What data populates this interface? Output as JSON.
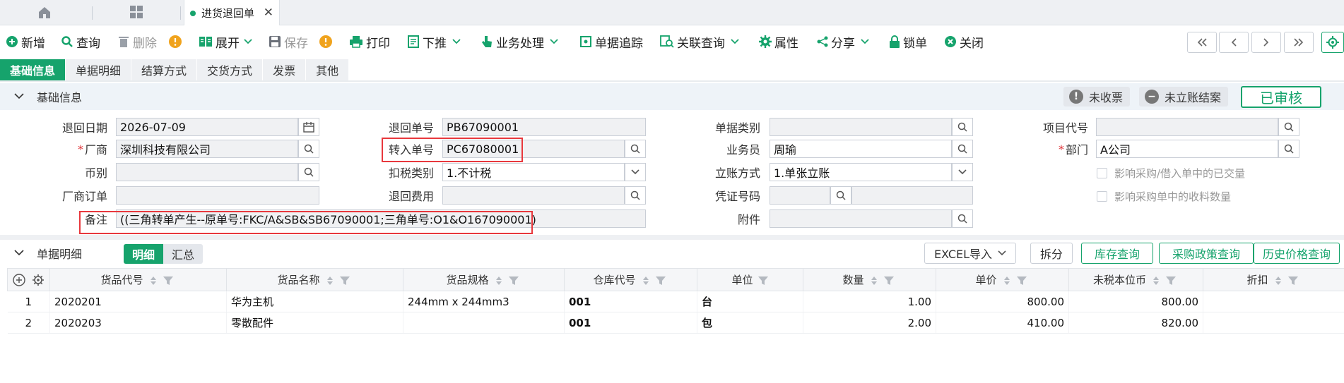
{
  "tabbar": {
    "active_tab": "进货退回单"
  },
  "toolbar": {
    "new": "新增",
    "query": "查询",
    "delete": "删除",
    "expand": "展开",
    "save": "保存",
    "print": "打印",
    "push_down": "下推",
    "business": "业务处理",
    "trace": "单据追踪",
    "related": "关联查询",
    "properties": "属性",
    "share": "分享",
    "lock": "锁单",
    "close": "关闭"
  },
  "subtabs": [
    "基础信息",
    "单据明细",
    "结算方式",
    "交货方式",
    "发票",
    "其他"
  ],
  "basic": {
    "title": "基础信息",
    "badge_unreceived": "未收票",
    "badge_unsettled": "未立账结案",
    "status": "已审核"
  },
  "form": {
    "return_date": {
      "label": "退回日期",
      "value": "2026-07-09"
    },
    "vendor": {
      "label": "厂商",
      "value": "深圳科技有限公司"
    },
    "currency": {
      "label": "币别",
      "value": ""
    },
    "vendor_order": {
      "label": "厂商订单",
      "value": ""
    },
    "remark": {
      "label": "备注",
      "value": "((三角转单产生--原单号:FKC/A&SB&SB67090001;三角单号:O1&O167090001)"
    },
    "return_no": {
      "label": "退回单号",
      "value": "PB67090001"
    },
    "transfer_no": {
      "label": "转入单号",
      "value": "PC67080001"
    },
    "tax_type": {
      "label": "扣税类别",
      "value": "1.不计税"
    },
    "return_fee": {
      "label": "退回费用",
      "value": ""
    },
    "doc_type": {
      "label": "单据类别",
      "value": ""
    },
    "salesman": {
      "label": "业务员",
      "value": "周瑜"
    },
    "account_method": {
      "label": "立账方式",
      "value": "1.单张立账"
    },
    "voucher_no": {
      "label": "凭证号码",
      "value": ""
    },
    "attachment": {
      "label": "附件",
      "value": ""
    },
    "project_code": {
      "label": "项目代号",
      "value": ""
    },
    "department": {
      "label": "部门",
      "value": "A公司"
    },
    "chk1": "影响采购/借入单中的已交量",
    "chk2": "影响采购单中的收料数量"
  },
  "detail": {
    "title": "单据明细",
    "seg_detail": "明细",
    "seg_summary": "汇总",
    "btn_excel": "EXCEL导入",
    "btn_split": "拆分",
    "btn_stock": "库存查询",
    "btn_policy": "采购政策查询",
    "btn_history": "历史价格查询",
    "columns": [
      "货品代号",
      "货品名称",
      "货品规格",
      "仓库代号",
      "单位",
      "数量",
      "单价",
      "未税本位币",
      "折扣"
    ],
    "rows": [
      {
        "no": "1",
        "code": "2020201",
        "name": "华为主机",
        "spec": "244mm x 244mm3",
        "wh": "001",
        "unit": "台",
        "qty": "1.00",
        "price": "800.00",
        "amount": "800.00",
        "discount": ""
      },
      {
        "no": "2",
        "code": "2020203",
        "name": "零散配件",
        "spec": "",
        "wh": "001",
        "unit": "包",
        "qty": "2.00",
        "price": "410.00",
        "amount": "820.00",
        "discount": ""
      }
    ]
  }
}
